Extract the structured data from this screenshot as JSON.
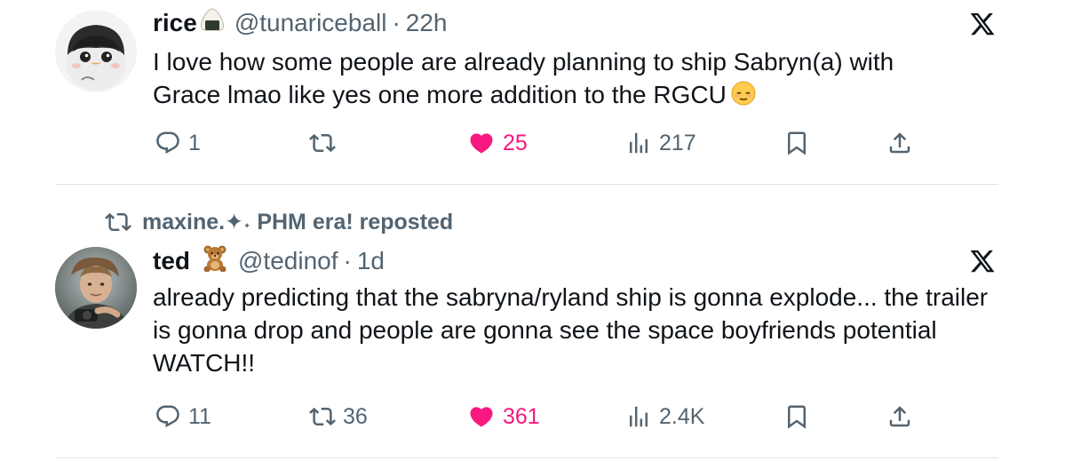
{
  "tweets": [
    {
      "name": "rice",
      "name_badge": "onigiri-emoji",
      "handle": "@tunariceball",
      "separator": "·",
      "time": "22h",
      "text": "I love how some people are already planning to ship Sabryn(a) with Grace lmao like yes one more addition to the RGCU",
      "trailing_emoji": "relieved-face-emoji",
      "replies": "1",
      "reposts": "",
      "likes": "25",
      "views": "217",
      "liked": true
    },
    {
      "reposted_by": "maxine.✦˖ PHM era! reposted",
      "name": "ted",
      "name_badge": "teddy-bear-emoji",
      "handle": "@tedinof",
      "separator": "·",
      "time": "1d",
      "text": "already predicting that the sabryna/ryland ship is gonna explode... the trailer is gonna drop and people are gonna see the space boyfriends potential WATCH!!",
      "replies": "11",
      "reposts": "36",
      "likes": "361",
      "views": "2.4K",
      "liked": true
    }
  ],
  "colors": {
    "text": "#0f1419",
    "secondary": "#536471",
    "like": "#f91880",
    "divider": "#dfe3e6"
  },
  "icons": [
    "x-logo-icon",
    "reply-icon",
    "repost-icon",
    "like-heart-icon",
    "views-icon",
    "bookmark-icon",
    "share-icon"
  ]
}
